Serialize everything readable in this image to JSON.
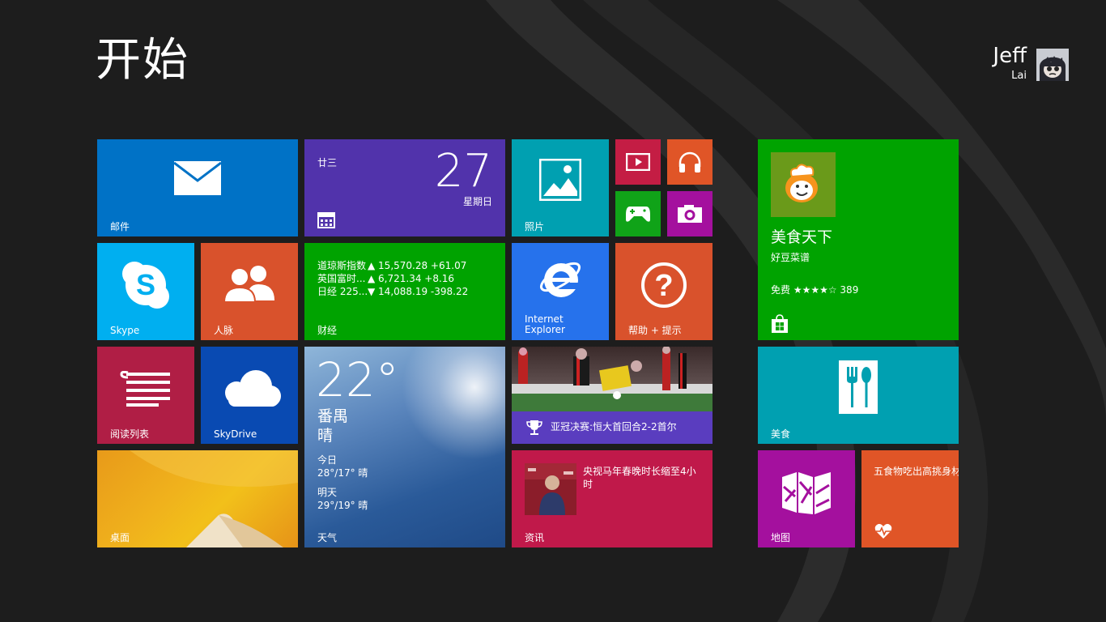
{
  "header": {
    "title": "开始"
  },
  "user": {
    "first_name": "Jeff",
    "last_name": "Lai"
  },
  "tiles": {
    "mail": {
      "label": "邮件",
      "color": "#0072c6",
      "icon": "mail-icon"
    },
    "calendar": {
      "lunar": "廿三",
      "day": "27",
      "weekday": "星期日",
      "color": "#5133ab",
      "icon": "calendar-icon"
    },
    "photos": {
      "label": "照片",
      "color": "#00a0b1",
      "icon": "photos-icon"
    },
    "video": {
      "color": "#c41d44",
      "icon": "video-icon"
    },
    "music": {
      "color": "#e05527",
      "icon": "headphones-icon"
    },
    "games": {
      "color": "#10a318",
      "icon": "xbox-controller-icon"
    },
    "camera": {
      "color": "#a4109e",
      "icon": "camera-icon"
    },
    "skype": {
      "label": "Skype",
      "color": "#00aff0",
      "icon": "skype-icon"
    },
    "people": {
      "label": "人脉",
      "color": "#d9522c",
      "icon": "people-icon"
    },
    "finance": {
      "label": "财经",
      "color": "#00a300",
      "rows": [
        {
          "name": "道琼斯指数",
          "value": "▲ 15,570.28 +61.07"
        },
        {
          "name": "英国富时...",
          "value": "▲ 6,721.34 +8.16"
        },
        {
          "name": "日经 225...",
          "value": "▼ 14,088.19 -398.22"
        }
      ]
    },
    "ie": {
      "label_line1": "Internet",
      "label_line2": "Explorer",
      "color": "#2672ec",
      "icon": "internet-explorer-icon"
    },
    "help": {
      "label": "帮助 + 提示",
      "color": "#d9522c",
      "icon": "question-icon"
    },
    "reading": {
      "label": "阅读列表",
      "color": "#b01e45",
      "icon": "reading-list-icon"
    },
    "skydrive": {
      "label": "SkyDrive",
      "color": "#094ab2",
      "icon": "cloud-icon"
    },
    "weather": {
      "label": "天气",
      "temp": "22°",
      "city": "番禺",
      "condition": "晴",
      "today_label": "今日",
      "today_value": "28°/17° 晴",
      "tomorrow_label": "明天",
      "tomorrow_value": "29°/19° 晴"
    },
    "sports": {
      "headline": "亚冠决赛:恒大首回合2-2首尔",
      "icon": "trophy-icon"
    },
    "news": {
      "label": "资讯",
      "headline": "央视马年春晚时长缩至4小时",
      "color": "#c0194a"
    },
    "desktop": {
      "label": "桌面"
    },
    "store_app": {
      "title": "美食天下",
      "subtitle": "好豆菜谱",
      "rating": "免费 ★★★★☆ 389",
      "color": "#00a300",
      "icon": "chef-icon"
    },
    "food": {
      "label": "美食",
      "color": "#00a0b1",
      "icon": "fork-spoon-icon"
    },
    "maps": {
      "label": "地图",
      "color": "#a4109e",
      "icon": "map-icon"
    },
    "health": {
      "text": "五食物吃出高挑身材",
      "color": "#e05527",
      "icon": "heartbeat-icon"
    }
  }
}
